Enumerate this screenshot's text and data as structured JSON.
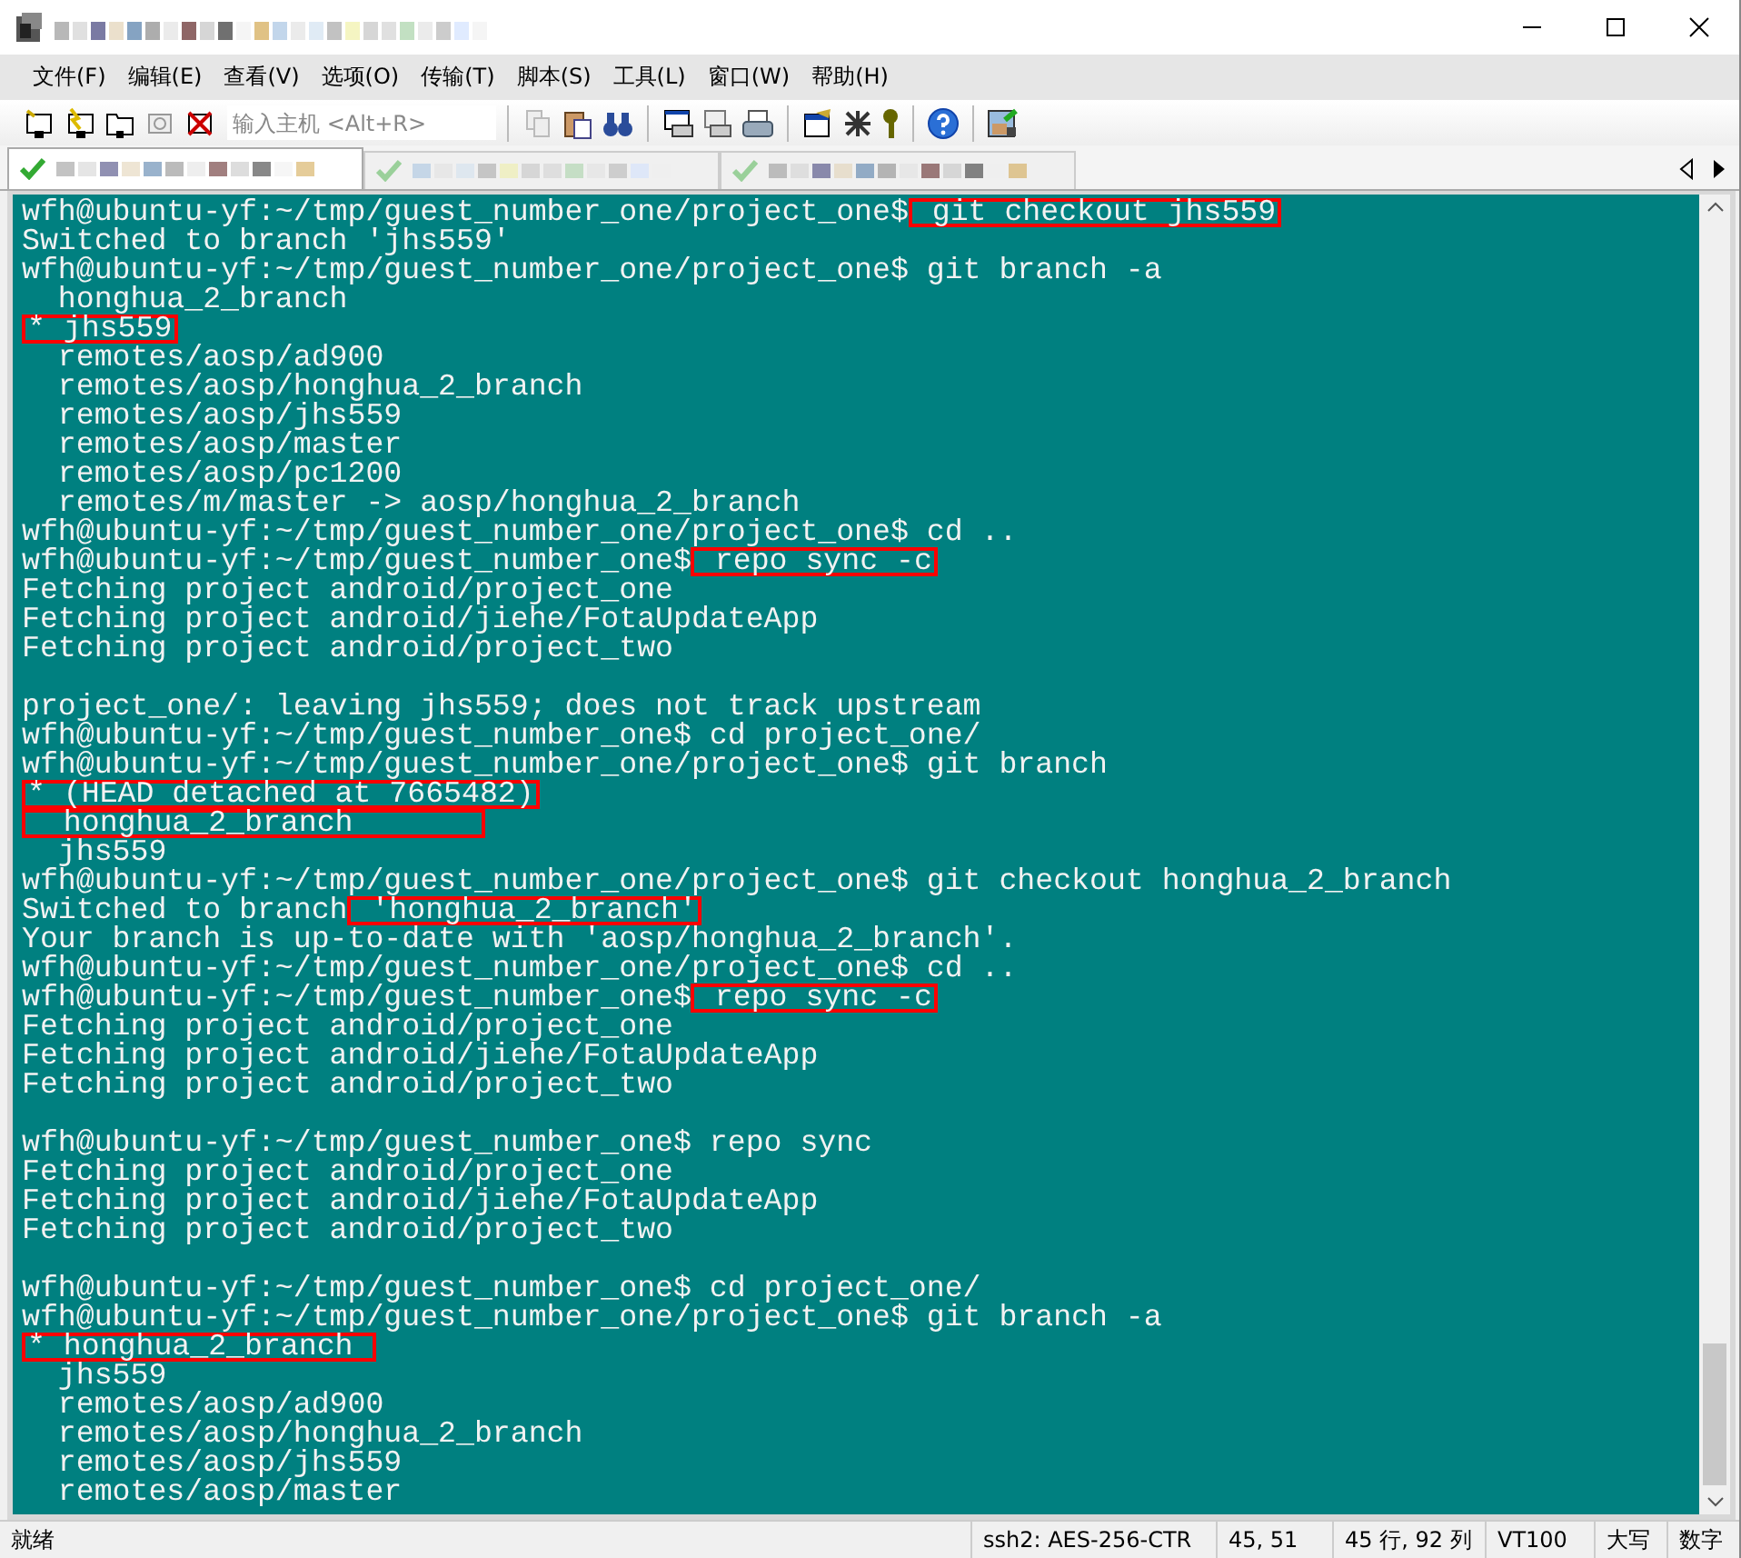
{
  "menu": [
    "文件(F)",
    "编辑(E)",
    "查看(V)",
    "选项(O)",
    "传输(T)",
    "脚本(S)",
    "工具(L)",
    "窗口(W)",
    "帮助(H)"
  ],
  "toolbar": {
    "host_field": {
      "placeholder": "输入主机 <Alt+R>"
    }
  },
  "tabs": [
    {
      "selected": true,
      "connected": true
    },
    {
      "selected": false,
      "connected": true
    },
    {
      "selected": false,
      "connected": true
    }
  ],
  "terminal": {
    "lines": [
      {
        "kind": "text",
        "parts": [
          {
            "text": "wfh@ubuntu-yf:~/tmp/guest_number_one/project_one$",
            "marked": false
          },
          {
            "text": " git checkout jhs559",
            "marked": true
          }
        ]
      },
      {
        "kind": "text",
        "parts": [
          {
            "text": "Switched to branch 'jhs559'",
            "marked": false
          }
        ]
      },
      {
        "kind": "text",
        "parts": [
          {
            "text": "wfh@ubuntu-yf:~/tmp/guest_number_one/project_one$ git branch -a",
            "marked": false
          }
        ]
      },
      {
        "kind": "text",
        "parts": [
          {
            "text": "  honghua_2_branch",
            "marked": false
          }
        ]
      },
      {
        "kind": "text",
        "parts": [
          {
            "text": "* jhs559",
            "marked": true
          }
        ]
      },
      {
        "kind": "text",
        "parts": [
          {
            "text": "  remotes/aosp/ad900",
            "marked": false
          }
        ]
      },
      {
        "kind": "text",
        "parts": [
          {
            "text": "  remotes/aosp/honghua_2_branch",
            "marked": false
          }
        ]
      },
      {
        "kind": "text",
        "parts": [
          {
            "text": "  remotes/aosp/jhs559",
            "marked": false
          }
        ]
      },
      {
        "kind": "text",
        "parts": [
          {
            "text": "  remotes/aosp/master",
            "marked": false
          }
        ]
      },
      {
        "kind": "text",
        "parts": [
          {
            "text": "  remotes/aosp/pc1200",
            "marked": false
          }
        ]
      },
      {
        "kind": "text",
        "parts": [
          {
            "text": "  remotes/m/master -> aosp/honghua_2_branch",
            "marked": false
          }
        ]
      },
      {
        "kind": "text",
        "parts": [
          {
            "text": "wfh@ubuntu-yf:~/tmp/guest_number_one/project_one$ cd ..",
            "marked": false
          }
        ]
      },
      {
        "kind": "text",
        "parts": [
          {
            "text": "wfh@ubuntu-yf:~/tmp/guest_number_one$",
            "marked": false
          },
          {
            "text": " repo sync -c",
            "marked": true
          }
        ]
      },
      {
        "kind": "text",
        "parts": [
          {
            "text": "Fetching project android/project_one",
            "marked": false
          }
        ]
      },
      {
        "kind": "text",
        "parts": [
          {
            "text": "Fetching project android/jiehe/FotaUpdateApp",
            "marked": false
          }
        ]
      },
      {
        "kind": "text",
        "parts": [
          {
            "text": "Fetching project android/project_two",
            "marked": false
          }
        ]
      },
      {
        "kind": "blank"
      },
      {
        "kind": "text",
        "parts": [
          {
            "text": "project_one/: leaving jhs559; does not track upstream",
            "marked": false
          }
        ]
      },
      {
        "kind": "text",
        "parts": [
          {
            "text": "wfh@ubuntu-yf:~/tmp/guest_number_one$ cd project_one/",
            "marked": false
          }
        ]
      },
      {
        "kind": "text",
        "parts": [
          {
            "text": "wfh@ubuntu-yf:~/tmp/guest_number_one/project_one$ git branch",
            "marked": false
          }
        ]
      },
      {
        "kind": "text",
        "parts": [
          {
            "text": "* (HEAD detached at 7665482)",
            "marked": true
          }
        ]
      },
      {
        "kind": "text",
        "parts": [
          {
            "text": "  honghua_2_branch       ",
            "marked": true
          }
        ]
      },
      {
        "kind": "text",
        "parts": [
          {
            "text": "  jhs559",
            "marked": false
          }
        ]
      },
      {
        "kind": "text",
        "parts": [
          {
            "text": "wfh@ubuntu-yf:~/tmp/guest_number_one/project_one$ git checkout honghua_2_branch",
            "marked": false
          }
        ]
      },
      {
        "kind": "text",
        "parts": [
          {
            "text": "Switched to branch",
            "marked": false
          },
          {
            "text": " 'honghua_2_branch'",
            "marked": true
          }
        ]
      },
      {
        "kind": "text",
        "parts": [
          {
            "text": "Your branch is up-to-date with 'aosp/honghua_2_branch'.",
            "marked": false
          }
        ]
      },
      {
        "kind": "text",
        "parts": [
          {
            "text": "wfh@ubuntu-yf:~/tmp/guest_number_one/project_one$ cd ..",
            "marked": false
          }
        ]
      },
      {
        "kind": "text",
        "parts": [
          {
            "text": "wfh@ubuntu-yf:~/tmp/guest_number_one$",
            "marked": false
          },
          {
            "text": " repo sync -c",
            "marked": true
          }
        ]
      },
      {
        "kind": "text",
        "parts": [
          {
            "text": "Fetching project android/project_one",
            "marked": false
          }
        ]
      },
      {
        "kind": "text",
        "parts": [
          {
            "text": "Fetching project android/jiehe/FotaUpdateApp",
            "marked": false
          }
        ]
      },
      {
        "kind": "text",
        "parts": [
          {
            "text": "Fetching project android/project_two",
            "marked": false
          }
        ]
      },
      {
        "kind": "blank"
      },
      {
        "kind": "text",
        "parts": [
          {
            "text": "wfh@ubuntu-yf:~/tmp/guest_number_one$ repo sync",
            "marked": false
          }
        ]
      },
      {
        "kind": "text",
        "parts": [
          {
            "text": "Fetching project android/project_one",
            "marked": false
          }
        ]
      },
      {
        "kind": "text",
        "parts": [
          {
            "text": "Fetching project android/jiehe/FotaUpdateApp",
            "marked": false
          }
        ]
      },
      {
        "kind": "text",
        "parts": [
          {
            "text": "Fetching project android/project_two",
            "marked": false
          }
        ]
      },
      {
        "kind": "blank"
      },
      {
        "kind": "text",
        "parts": [
          {
            "text": "wfh@ubuntu-yf:~/tmp/guest_number_one$ cd project_one/",
            "marked": false
          }
        ]
      },
      {
        "kind": "text",
        "parts": [
          {
            "text": "wfh@ubuntu-yf:~/tmp/guest_number_one/project_one$ git branch -a",
            "marked": false
          }
        ]
      },
      {
        "kind": "text",
        "parts": [
          {
            "text": "* honghua_2_branch ",
            "marked": true
          }
        ]
      },
      {
        "kind": "text",
        "parts": [
          {
            "text": "  jhs559",
            "marked": false
          }
        ]
      },
      {
        "kind": "text",
        "parts": [
          {
            "text": "  remotes/aosp/ad900",
            "marked": false
          }
        ]
      },
      {
        "kind": "text",
        "parts": [
          {
            "text": "  remotes/aosp/honghua_2_branch",
            "marked": false
          }
        ]
      },
      {
        "kind": "text",
        "parts": [
          {
            "text": "  remotes/aosp/jhs559",
            "marked": false
          }
        ]
      },
      {
        "kind": "text",
        "parts": [
          {
            "text": "  remotes/aosp/master",
            "marked": false
          }
        ]
      }
    ]
  },
  "status_bar": {
    "message": "就绪",
    "cipher": "ssh2: AES-256-CTR",
    "cursor": "45,  51",
    "size": "45 行, 92 列",
    "emulation": "VT100",
    "caps": "大写",
    "num": "数字"
  }
}
